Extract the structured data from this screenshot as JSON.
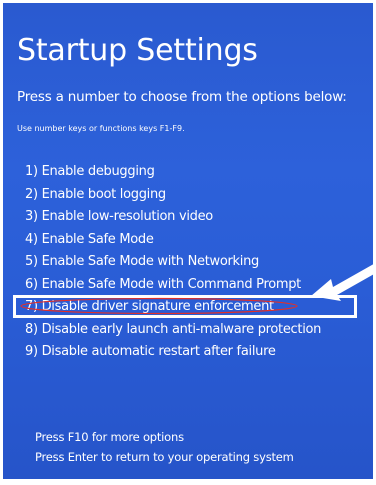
{
  "title": "Startup Settings",
  "subtitle": "Press a number to choose from the options below:",
  "hint": "Use number keys or functions keys F1-F9.",
  "options": [
    {
      "label": "1) Enable debugging"
    },
    {
      "label": "2) Enable boot logging"
    },
    {
      "label": "3) Enable low-resolution video"
    },
    {
      "label": "4) Enable Safe Mode"
    },
    {
      "label": "5) Enable Safe Mode with Networking"
    },
    {
      "label": "6) Enable Safe Mode with Command Prompt"
    },
    {
      "label": "7) Disable driver signature enforcement"
    },
    {
      "label": "8) Disable early launch anti-malware protection"
    },
    {
      "label": "9) Disable automatic restart after failure"
    }
  ],
  "footer": {
    "more_options": "Press F10 for more options",
    "return": "Press Enter to return to your operating system"
  },
  "highlighted_option_index": 6,
  "colors": {
    "background": "#2d61da",
    "text": "#ffffff",
    "highlight_border": "#ffffff",
    "annotation_ellipse": "#e0302a",
    "arrow": "#ffffff"
  },
  "icons": {
    "arrow": "annotation-arrow-icon"
  }
}
